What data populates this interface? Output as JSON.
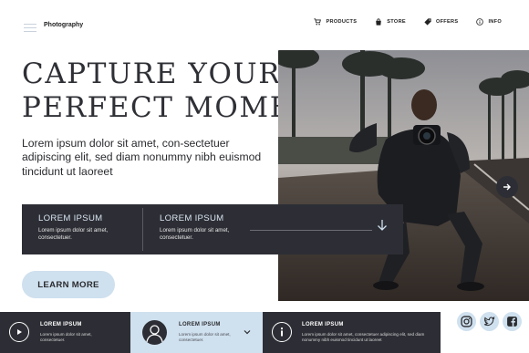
{
  "nav": {
    "brand": "Photography",
    "links": [
      {
        "label": "PRODUCTS",
        "icon": "cart-icon"
      },
      {
        "label": "STORE",
        "icon": "bag-icon"
      },
      {
        "label": "OFFERS",
        "icon": "tag-icon"
      },
      {
        "label": "INFO",
        "icon": "info-icon"
      }
    ]
  },
  "hero": {
    "headline_line1": "CAPTURE YOUR",
    "headline_line2": "PERFECT MOMENT",
    "lead": "Lorem ipsum dolor sit amet, con-sectetuer adipiscing elit, sed diam nonummy nibh euismod tincidunt ut laoreet",
    "cta_label": "LEARN MORE"
  },
  "infobar": {
    "items": [
      {
        "title": "LOREM IPSUM",
        "text": "Lorem ipsum dolor sit amet, consectetuer."
      },
      {
        "title": "LOREM IPSUM",
        "text": "Lorem ipsum dolor sit amet, consectetuer."
      }
    ]
  },
  "strip": [
    {
      "title": "LOREM IPSUM",
      "text": "Lorem ipsum dolor sit amet, consectetuer.",
      "icon": "play-icon"
    },
    {
      "title": "LOREM IPSUM",
      "text": "Lorem ipsum dolor sit amet, consectetuer.",
      "icon": "user-avatar"
    },
    {
      "title": "LOREM IPSUM",
      "text": "Lorem ipsum dolor sit amet, consectetuer adipiscing elit, sed diam nonummy nibh euismod tincidunt ut laoreet",
      "icon": "info-icon"
    }
  ],
  "socials": [
    "instagram-icon",
    "twitter-icon",
    "facebook-icon"
  ],
  "colors": {
    "dark": "#2d2e35",
    "accent": "#cfe0ee",
    "text": "#2a2b2f"
  }
}
